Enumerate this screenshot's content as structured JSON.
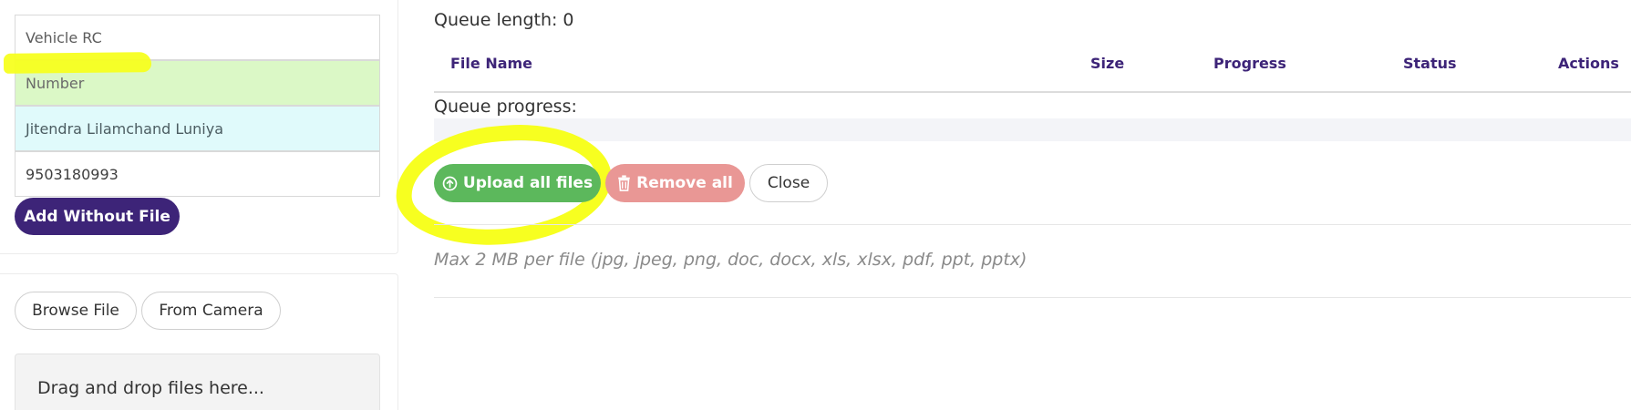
{
  "form": {
    "fields": [
      {
        "value": "Vehicle RC"
      },
      {
        "value": "Number"
      },
      {
        "value": "Jitendra Lilamchand Luniya"
      },
      {
        "value": "9503180993"
      }
    ],
    "add_without_file_label": "Add Without File"
  },
  "upload_sources": {
    "browse_label": "Browse File",
    "camera_label": "From Camera",
    "dropzone_text": "Drag and drop files here..."
  },
  "queue": {
    "length_label": "Queue length:",
    "length_value": "0",
    "columns": [
      "File Name",
      "Size",
      "Progress",
      "Status",
      "Actions"
    ],
    "progress_label": "Queue progress:",
    "progress_fraction": 0
  },
  "actions": {
    "upload_all_label": "Upload all files",
    "remove_all_label": "Remove all",
    "close_label": "Close"
  },
  "hint": {
    "text": "Max 2 MB per file (jpg, jpeg, png, doc, docx, xls, xlsx, pdf, ppt, pptx)"
  },
  "colors": {
    "primary": "#3d2478",
    "success": "#5cb85c",
    "danger": "#e99795",
    "highlight": "#f7ff20",
    "field_green": "#dbf8c6",
    "field_cyan": "#e0fafb"
  },
  "icons": {
    "upload": "circle-arrow-up-icon",
    "remove": "trash-icon"
  }
}
